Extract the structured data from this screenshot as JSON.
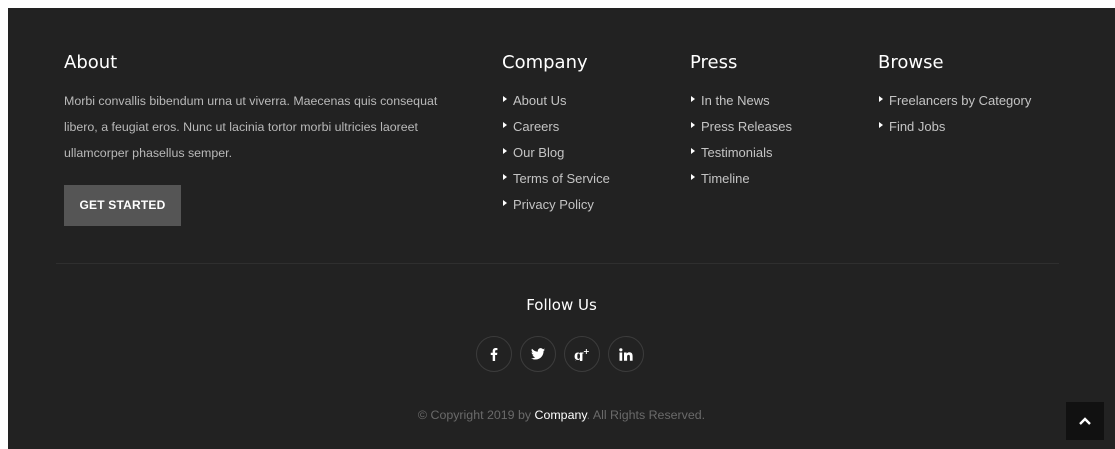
{
  "about": {
    "title": "About",
    "text": "Morbi convallis bibendum urna ut viverra. Maecenas quis consequat libero, a feugiat eros. Nunc ut lacinia tortor morbi ultricies laoreet ullamcorper phasellus semper.",
    "cta_label": "GET STARTED"
  },
  "company": {
    "title": "Company",
    "links": [
      "About Us",
      "Careers",
      "Our Blog",
      "Terms of Service",
      "Privacy Policy"
    ]
  },
  "press": {
    "title": "Press",
    "links": [
      "In the News",
      "Press Releases",
      "Testimonials",
      "Timeline"
    ]
  },
  "browse": {
    "title": "Browse",
    "links": [
      "Freelancers by Category",
      "Find Jobs"
    ]
  },
  "follow": {
    "title": "Follow Us",
    "icons": [
      "facebook-icon",
      "twitter-icon",
      "google-plus-icon",
      "linkedin-icon"
    ]
  },
  "copyright": {
    "prefix": "© Copyright 2019 by ",
    "brand": "Company",
    "suffix": ". All Rights Reserved."
  },
  "back_to_top": {
    "icon": "chevron-up-icon"
  },
  "colors": {
    "background": "#222222",
    "button": "#555555",
    "heading": "#ffffff",
    "text": "#b9b9b9"
  }
}
